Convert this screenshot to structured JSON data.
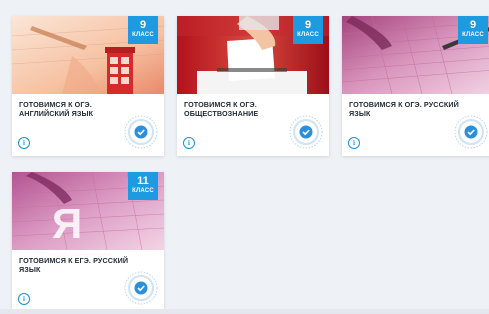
{
  "courses": [
    {
      "badge_number": "9",
      "badge_label": "КЛАСС",
      "title": "ГОТОВИМСЯ К ОГЭ. АНГЛИЙСКИЙ ЯЗЫК",
      "thumbnail_icon": "phone-booth-image"
    },
    {
      "badge_number": "9",
      "badge_label": "КЛАСС",
      "title": "ГОТОВИМСЯ К ОГЭ. ОБЩЕСТВОЗНАНИЕ",
      "thumbnail_icon": "ballot-box-image"
    },
    {
      "badge_number": "9",
      "badge_label": "КЛАСС",
      "title": "ГОТОВИМСЯ К ОГЭ. РУССКИЙ ЯЗЫК",
      "thumbnail_icon": "exam-form-image"
    },
    {
      "badge_number": "11",
      "badge_label": "КЛАСС",
      "title": "ГОТОВИМСЯ К ЕГЭ. РУССКИЙ ЯЗЫК",
      "thumbnail_icon": "letter-ya-form-image"
    }
  ],
  "colors": {
    "badge": "#1e9be0",
    "info": "#1e8fd5",
    "background": "#eef1f5"
  }
}
